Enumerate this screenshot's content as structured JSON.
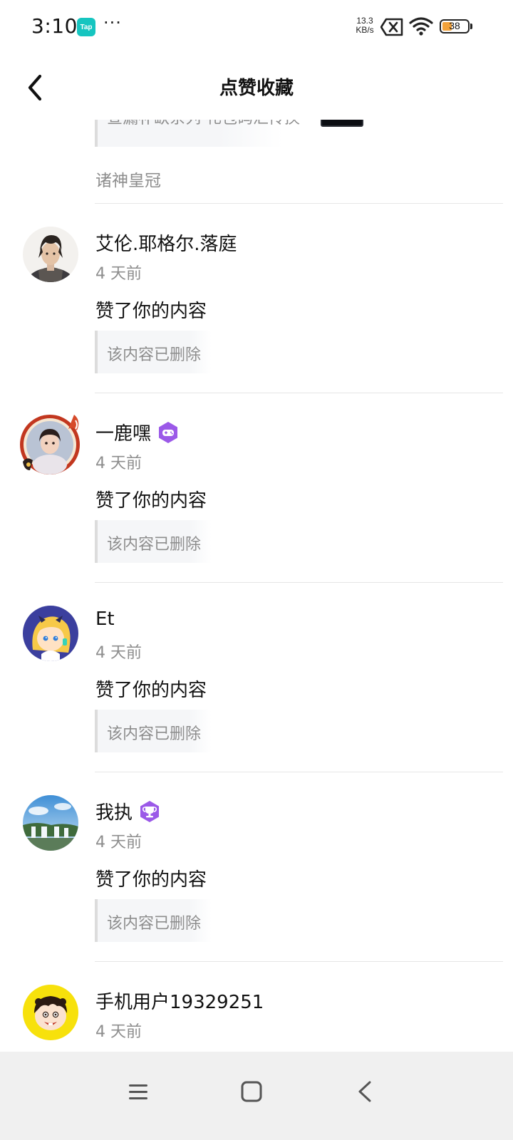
{
  "status_bar": {
    "time": "3:10",
    "app_badge": "Tap",
    "more": "···",
    "net_speed_value": "13.3",
    "net_speed_unit": "KB/s",
    "battery_level": "38",
    "battery_fraction": 0.38,
    "battery_color": "#f3a23a"
  },
  "header": {
    "title": "点赞收藏",
    "back_icon": "chevron-left-icon"
  },
  "partial_item": {
    "quote": "查漏补缺系列 礼包码汇传换",
    "game": "诸神皇冠"
  },
  "items": [
    {
      "username": "艾伦.耶格尔.落庭",
      "time": "4 天前",
      "action": "赞了你的内容",
      "quote": "该内容已删除",
      "avatar": "anime-character-avatar",
      "badge": null
    },
    {
      "username": "一鹿嘿",
      "time": "4 天前",
      "action": "赞了你的内容",
      "quote": "该内容已删除",
      "avatar": "girl-photo-avatar-with-frame",
      "badge": "gamepad-badge-icon"
    },
    {
      "username": "Et",
      "time": "4 天前",
      "action": "赞了你的内容",
      "quote": "该内容已删除",
      "avatar": "cartoon-girl-avatar",
      "badge": null
    },
    {
      "username": "我执",
      "time": "4 天前",
      "action": "赞了你的内容",
      "quote": "该内容已删除",
      "avatar": "waterfall-landscape-avatar",
      "badge": "trophy-badge-icon"
    },
    {
      "username": "手机用户19329251",
      "time": "4 天前",
      "avatar": "cartoon-kid-avatar",
      "badge": null
    }
  ],
  "nav_bar": {
    "menu_icon": "menu-icon",
    "home_icon": "home-square-icon",
    "back_icon": "back-triangle-icon"
  },
  "colors": {
    "badge_purple": "#9b59e8",
    "muted_text": "#8d8d8d",
    "accent_teal": "#16c5c0"
  }
}
